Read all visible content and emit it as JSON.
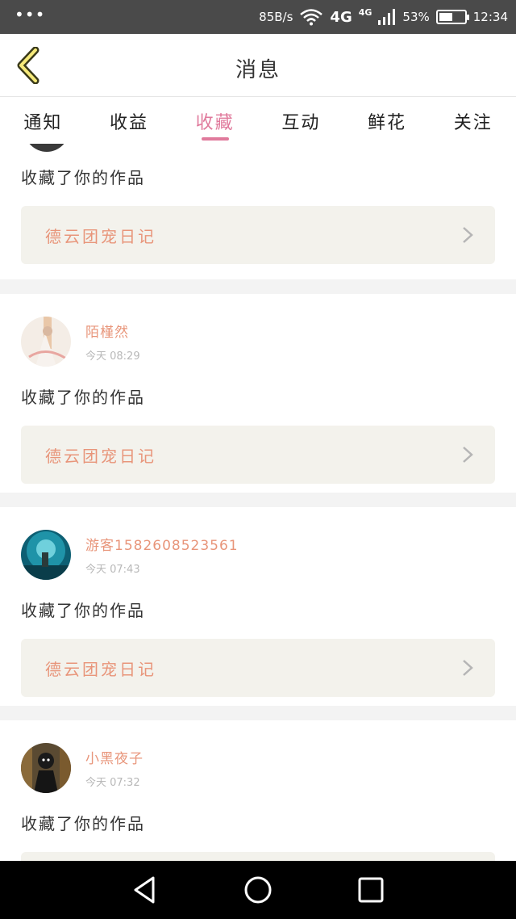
{
  "status_bar": {
    "dots": "•••",
    "net_speed": "85B/s",
    "network": "4G",
    "network_small": "4G",
    "battery_percent": "53%",
    "battery_level": 0.53,
    "time": "12:34"
  },
  "header": {
    "title": "消息",
    "back_icon": "chevron-left-icon"
  },
  "tabs": [
    {
      "label": "通知"
    },
    {
      "label": "收益"
    },
    {
      "label": "收藏",
      "active": true
    },
    {
      "label": "互动"
    },
    {
      "label": "鲜花"
    },
    {
      "label": "关注"
    }
  ],
  "items": [
    {
      "action": "收藏了你的作品",
      "work_title": "德云团宠日记"
    },
    {
      "user": "陌槿然",
      "time": "今天 08:29",
      "action": "收藏了你的作品",
      "work_title": "德云团宠日记"
    },
    {
      "user": "游客1582608523561",
      "time": "今天 07:43",
      "action": "收藏了你的作品",
      "work_title": "德云团宠日记"
    },
    {
      "user": "小黑夜子",
      "time": "今天 07:32",
      "action": "收藏了你的作品",
      "work_title": ""
    }
  ],
  "colors": {
    "accent": "#e07a9c",
    "name": "#e8957a",
    "card_link_bg": "#f3f2ec"
  },
  "nav": {
    "back": "triangle-back-icon",
    "home": "circle-home-icon",
    "recent": "square-recent-icon"
  }
}
